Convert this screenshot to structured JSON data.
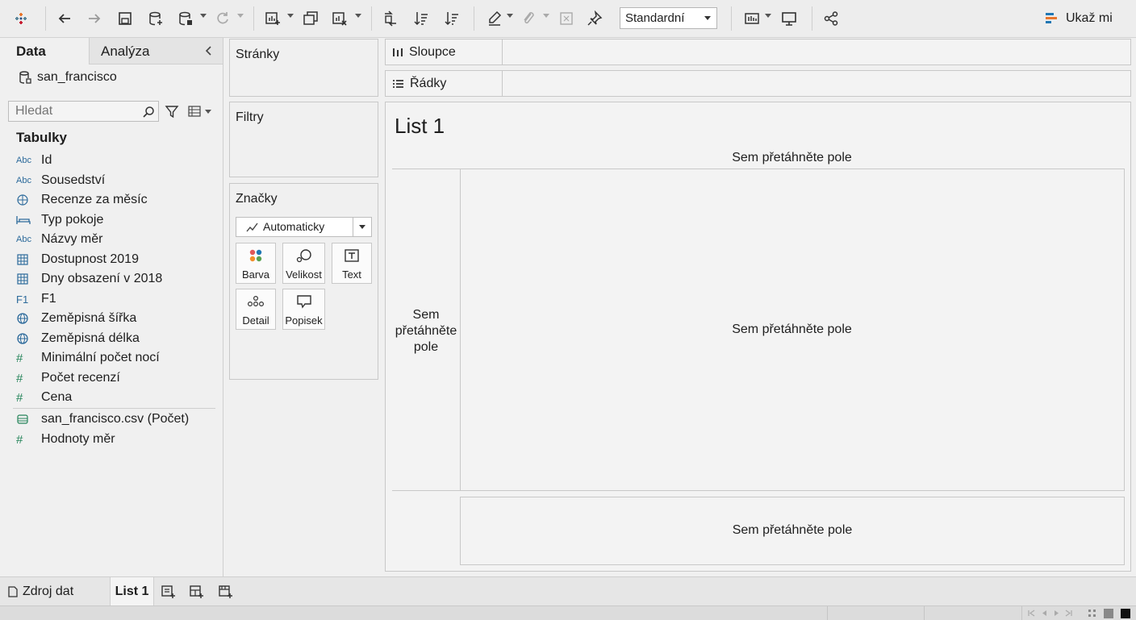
{
  "toolbar": {
    "view_mode": "Standardní",
    "show_me": "Ukaž mi",
    "icons": [
      "tableau-logo-icon",
      "undo-icon",
      "redo-icon",
      "save-icon",
      "new-datasource-icon",
      "pause-updates-icon",
      "refresh-icon",
      "new-worksheet-icon",
      "duplicate-icon",
      "clear-sheet-icon",
      "swap-icon",
      "sort-ascending-icon",
      "sort-descending-icon",
      "highlight-icon",
      "annotate-icon",
      "fixed-axes-icon",
      "pin-icon",
      "fit-icon",
      "presentation-icon",
      "share-icon"
    ]
  },
  "data_pane": {
    "tab_data": "Data",
    "tab_analysis": "Analýza",
    "datasource": "san_francisco",
    "search_placeholder": "Hledat",
    "tables_heading": "Tabulky",
    "fields": [
      {
        "type": "Abc",
        "name": "Id"
      },
      {
        "type": "Abc",
        "name": "Sousedství"
      },
      {
        "type": "geo-grid",
        "name": "Recenze za měsíc"
      },
      {
        "type": "bed",
        "name": "Typ pokoje"
      },
      {
        "type": "Abc",
        "name": "Názvy měr"
      },
      {
        "type": "table",
        "name": "Dostupnost 2019"
      },
      {
        "type": "table",
        "name": "Dny obsazení v 2018"
      },
      {
        "type": "F1",
        "name": "F1"
      },
      {
        "type": "globe",
        "name": "Zeměpisná šířka"
      },
      {
        "type": "globe",
        "name": "Zeměpisná délka"
      },
      {
        "type": "#",
        "name": "Minimální počet nocí"
      },
      {
        "type": "#",
        "name": "Počet recenzí"
      },
      {
        "type": "#",
        "name": "Cena"
      },
      {
        "type": "count",
        "name": "san_francisco.csv (Počet)"
      },
      {
        "type": "#",
        "name": "Hodnoty měr"
      }
    ]
  },
  "shelves": {
    "pages": "Stránky",
    "filters": "Filtry",
    "marks": "Značky",
    "mark_type": "Automaticky",
    "mark_buttons": [
      "Barva",
      "Velikost",
      "Text",
      "Detail",
      "Popisek"
    ],
    "columns": "Sloupce",
    "rows": "Řádky"
  },
  "canvas": {
    "title": "List 1",
    "drop_top": "Sem přetáhněte pole",
    "drop_left": "Sem přetáhněte pole",
    "drop_center": "Sem přetáhněte pole",
    "drop_bottom": "Sem přetáhněte pole"
  },
  "bottom": {
    "source_tab": "Zdroj dat",
    "sheet_tab": "List 1"
  }
}
